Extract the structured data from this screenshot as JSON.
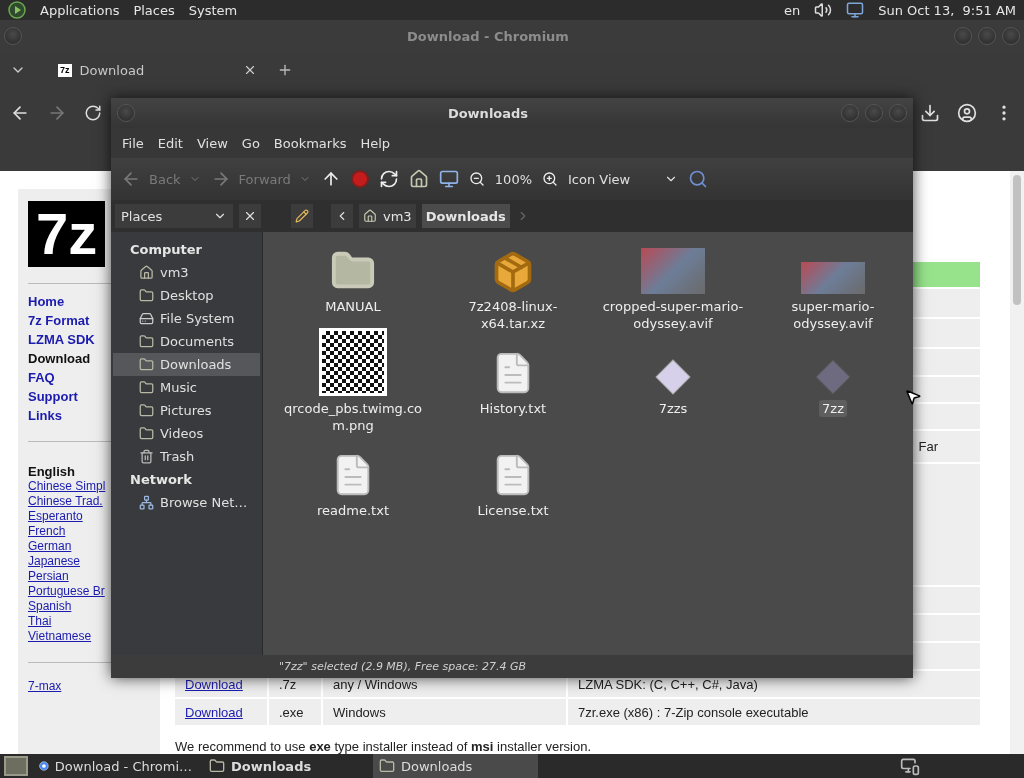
{
  "top_panel": {
    "menus": [
      "Applications",
      "Places",
      "System"
    ],
    "keyboard": "en",
    "clock": "Sun Oct 13,  9:51 AM"
  },
  "browser": {
    "title": "Download - Chromium",
    "tabs": [
      {
        "label": "Download",
        "favicon": "7z",
        "selected": true
      }
    ],
    "page": {
      "logo": "7z",
      "nav": [
        {
          "label": "Home",
          "selected": false
        },
        {
          "label": "7z Format",
          "selected": false
        },
        {
          "label": "LZMA SDK",
          "selected": false
        },
        {
          "label": "Download",
          "selected": true
        },
        {
          "label": "FAQ",
          "selected": false
        },
        {
          "label": "Support",
          "selected": false
        },
        {
          "label": "Links",
          "selected": false
        }
      ],
      "language_heading": "English",
      "languages": [
        "Chinese Simpl",
        "Chinese Trad.",
        "Esperanto",
        "French",
        "German",
        "Japanese",
        "Persian",
        "Portuguese Br",
        "Spanish",
        "Thai",
        "Vietnamese"
      ],
      "extra_link": "7-max",
      "table_fragment": "Far",
      "rows": [
        {
          "link": "Download",
          "type": ".7z",
          "system": "any / Windows",
          "description": "LZMA SDK: (C, C++, C#, Java)"
        },
        {
          "link": "Download",
          "type": ".exe",
          "system": "Windows",
          "description": "7zr.exe (x86) : 7-Zip console executable"
        }
      ],
      "note": "We recommend to use **exe** type installer instead of **msi** installer version."
    }
  },
  "file_manager": {
    "title": "Downloads",
    "menus": [
      "File",
      "Edit",
      "View",
      "Go",
      "Bookmarks",
      "Help"
    ],
    "toolbar": {
      "back": {
        "label": "Back",
        "disabled": true
      },
      "forward": {
        "label": "Forward",
        "disabled": true
      },
      "zoom": "100%",
      "view": "Icon View"
    },
    "side_selector": "Places",
    "path": [
      {
        "label": "vm3",
        "selected": false
      },
      {
        "label": "Downloads",
        "selected": true
      }
    ],
    "sidebar": [
      {
        "heading": "Computer",
        "items": [
          {
            "label": "vm3",
            "kind": "home",
            "selected": false
          },
          {
            "label": "Desktop",
            "kind": "folder",
            "selected": false
          },
          {
            "label": "File System",
            "kind": "drive",
            "selected": false
          },
          {
            "label": "Documents",
            "kind": "folder",
            "selected": false
          },
          {
            "label": "Downloads",
            "kind": "folder",
            "selected": true
          },
          {
            "label": "Music",
            "kind": "folder",
            "selected": false
          },
          {
            "label": "Pictures",
            "kind": "folder",
            "selected": false
          },
          {
            "label": "Videos",
            "kind": "folder",
            "selected": false
          },
          {
            "label": "Trash",
            "kind": "trash",
            "selected": false
          }
        ]
      },
      {
        "heading": "Network",
        "items": [
          {
            "label": "Browse Net…",
            "kind": "network",
            "selected": false
          }
        ]
      }
    ],
    "files": [
      {
        "name": "MANUAL",
        "kind": "folder",
        "selected": false
      },
      {
        "name": "7z2408-linux-x64.tar.xz",
        "kind": "archive",
        "selected": false
      },
      {
        "name": "cropped-super-mario-odyssey.avif",
        "kind": "photo",
        "selected": false
      },
      {
        "name": "super-mario-odyssey.avif",
        "kind": "wide-photo",
        "selected": false
      },
      {
        "name": "qrcode_pbs.twimg.com.png",
        "kind": "qr",
        "selected": false
      },
      {
        "name": "History.txt",
        "kind": "text",
        "selected": false
      },
      {
        "name": "7zzs",
        "kind": "executable",
        "selected": false
      },
      {
        "name": "7zz",
        "kind": "executable",
        "selected": true
      },
      {
        "name": "readme.txt",
        "kind": "text",
        "selected": false
      },
      {
        "name": "License.txt",
        "kind": "text",
        "selected": false
      }
    ],
    "status": "\"7zz\" selected (2.9 MB), Free space: 27.4 GB"
  },
  "taskbar": [
    {
      "label": "Download - Chromi…",
      "kind": "browser",
      "selected": false,
      "emphasized": false
    },
    {
      "label": "Downloads",
      "kind": "folder",
      "selected": false,
      "emphasized": true
    },
    {
      "label": "Downloads",
      "kind": "folder",
      "selected": true,
      "emphasized": false
    }
  ]
}
